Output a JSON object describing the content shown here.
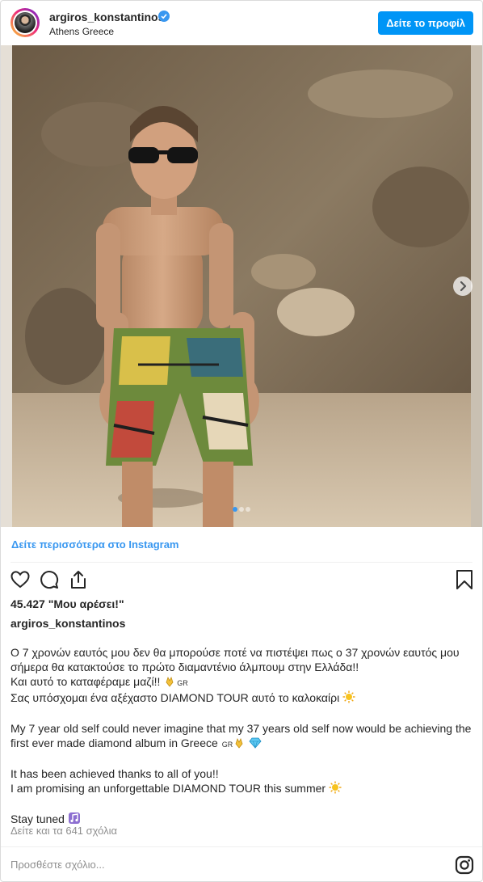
{
  "header": {
    "username": "argiros_konstantinos",
    "location": "Athens Greece",
    "profile_button": "Δείτε το προφίλ"
  },
  "carousel": {
    "slide_count": 3,
    "active_slide": 1
  },
  "post": {
    "see_more": "Δείτε περισσότερα στο Instagram",
    "likes": "45.427 \"Μου αρέσει!\"",
    "author": "argiros_konstantinos",
    "caption": {
      "p1_l1": "Ο 7 χρονών εαυτός μου δεν θα μπορούσε ποτέ να πιστέψει πως ο 37 χρονών εαυτός μου",
      "p1_l2": "σήμερα θα κατακτούσε το πρώτο διαμαντένιο άλμπουμ στην Ελλάδα!!",
      "p1_l3": "Και αυτό το καταφέραμε μαζί!! ",
      "p1_l4": "Σας υπόσχομαι ένα αξέχαστο DIAMOND TOUR αυτό το καλοκαίρι ",
      "p2_l1": "My 7 year old self could never imagine that my 37 years old self now would be achieving the",
      "p2_l2": "first ever made diamond album in Greece ",
      "p3_l1": "It has been achieved thanks to all of you!!",
      "p3_l2": "I am promising an unforgettable DIAMOND TOUR this summer ",
      "p4_l1": "Stay tuned ",
      "flag_code": "GR"
    },
    "comments_link": "Δείτε και τα 641 σχόλια",
    "comment_placeholder": "Προσθέστε σχόλιο..."
  },
  "colors": {
    "accent": "#3897f0",
    "button": "#0095f6",
    "muted": "#8e8e8e"
  },
  "icons": [
    "verified-badge-icon",
    "heart-icon",
    "comment-icon",
    "share-icon",
    "bookmark-icon",
    "chevron-right-icon",
    "instagram-logo-icon",
    "pray-emoji",
    "sun-emoji",
    "diamond-emoji",
    "music-emoji"
  ]
}
